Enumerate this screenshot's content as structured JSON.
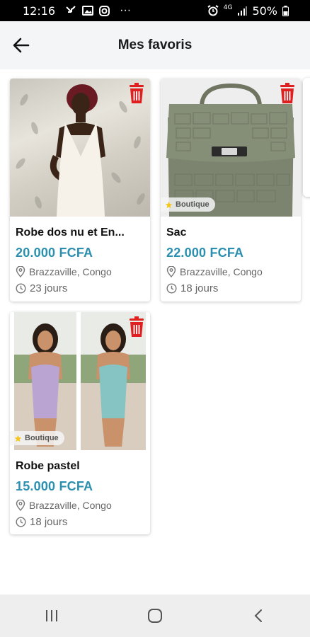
{
  "status_bar": {
    "time": "12:16",
    "more": "···",
    "battery": "50%",
    "network": "4G"
  },
  "header": {
    "title": "Mes favoris",
    "back_icon": "arrow-left-icon"
  },
  "products": [
    {
      "name": "Robe dos nu et En...",
      "price": "20.000 FCFA",
      "location": "Brazzaville, Congo",
      "age": "23 jours",
      "badge": ""
    },
    {
      "name": "Sac",
      "price": "22.000 FCFA",
      "location": "Brazzaville, Congo",
      "age": "18 jours",
      "badge": "Boutique"
    },
    {
      "name": "Robe pastel",
      "price": "15.000 FCFA",
      "location": "Brazzaville, Congo",
      "age": "18 jours",
      "badge": "Boutique"
    }
  ],
  "colors": {
    "price": "#2b8fb0",
    "trash": "#e02020",
    "badge_star": "#f5c518",
    "header_bg": "#f4f5f7"
  },
  "nav": {
    "recents_icon": "recents-icon",
    "home_icon": "home-icon",
    "back_icon": "back-chevron-icon"
  }
}
